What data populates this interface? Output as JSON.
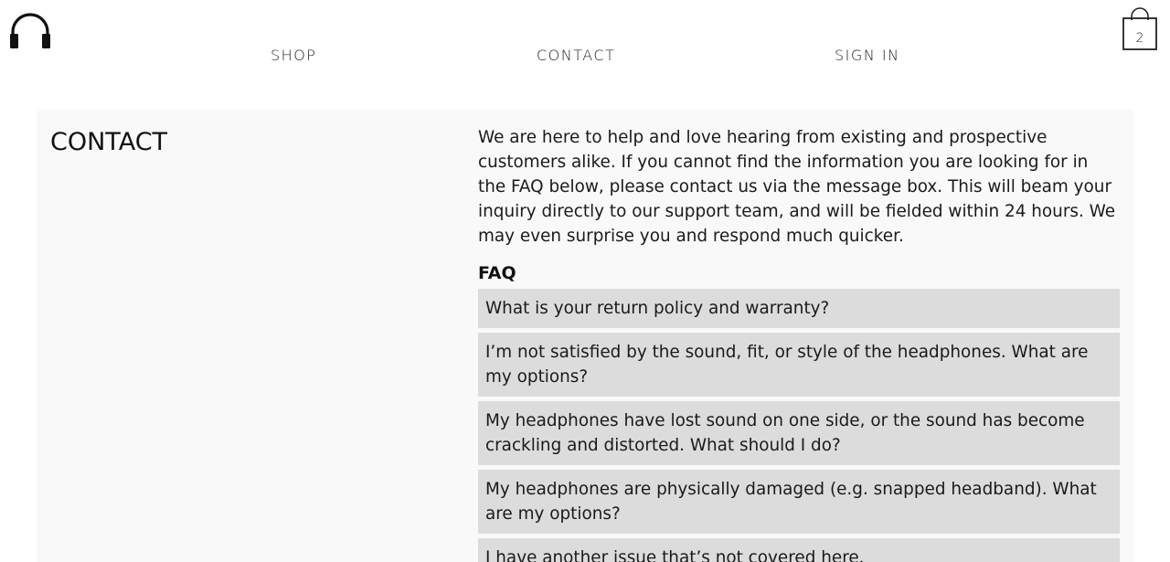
{
  "header": {
    "logo_icon": "headphones-icon",
    "nav": [
      {
        "label": "SHOP"
      },
      {
        "label": "CONTACT"
      },
      {
        "label": "SIGN IN"
      }
    ],
    "cart": {
      "icon": "shopping-bag-icon",
      "count": "2"
    }
  },
  "main": {
    "title": "CONTACT",
    "intro": "We are here to help and love hearing from existing and prospective customers alike. If you cannot find the information you are looking for in the FAQ below, please contact us via the message box. This will beam your inquiry directly to our support team, and will be fielded within 24 hours. We may even surprise you and respond much quicker.",
    "faq_heading": "FAQ",
    "faq_items": [
      {
        "question": "What is your return policy and warranty?"
      },
      {
        "question": "I’m not satisfied by the sound, fit, or style of the headphones. What are my options?"
      },
      {
        "question": "My headphones have lost sound on one side, or the sound has become crackling and distorted. What should I do?"
      },
      {
        "question": "My headphones are physically damaged (e.g. snapped headband). What are my options?"
      },
      {
        "question": "I have another issue that’s not covered here."
      }
    ]
  },
  "colors": {
    "panel_background": "#f9f9f9",
    "faq_item_background": "#dcdcdc",
    "text": "#111111"
  }
}
